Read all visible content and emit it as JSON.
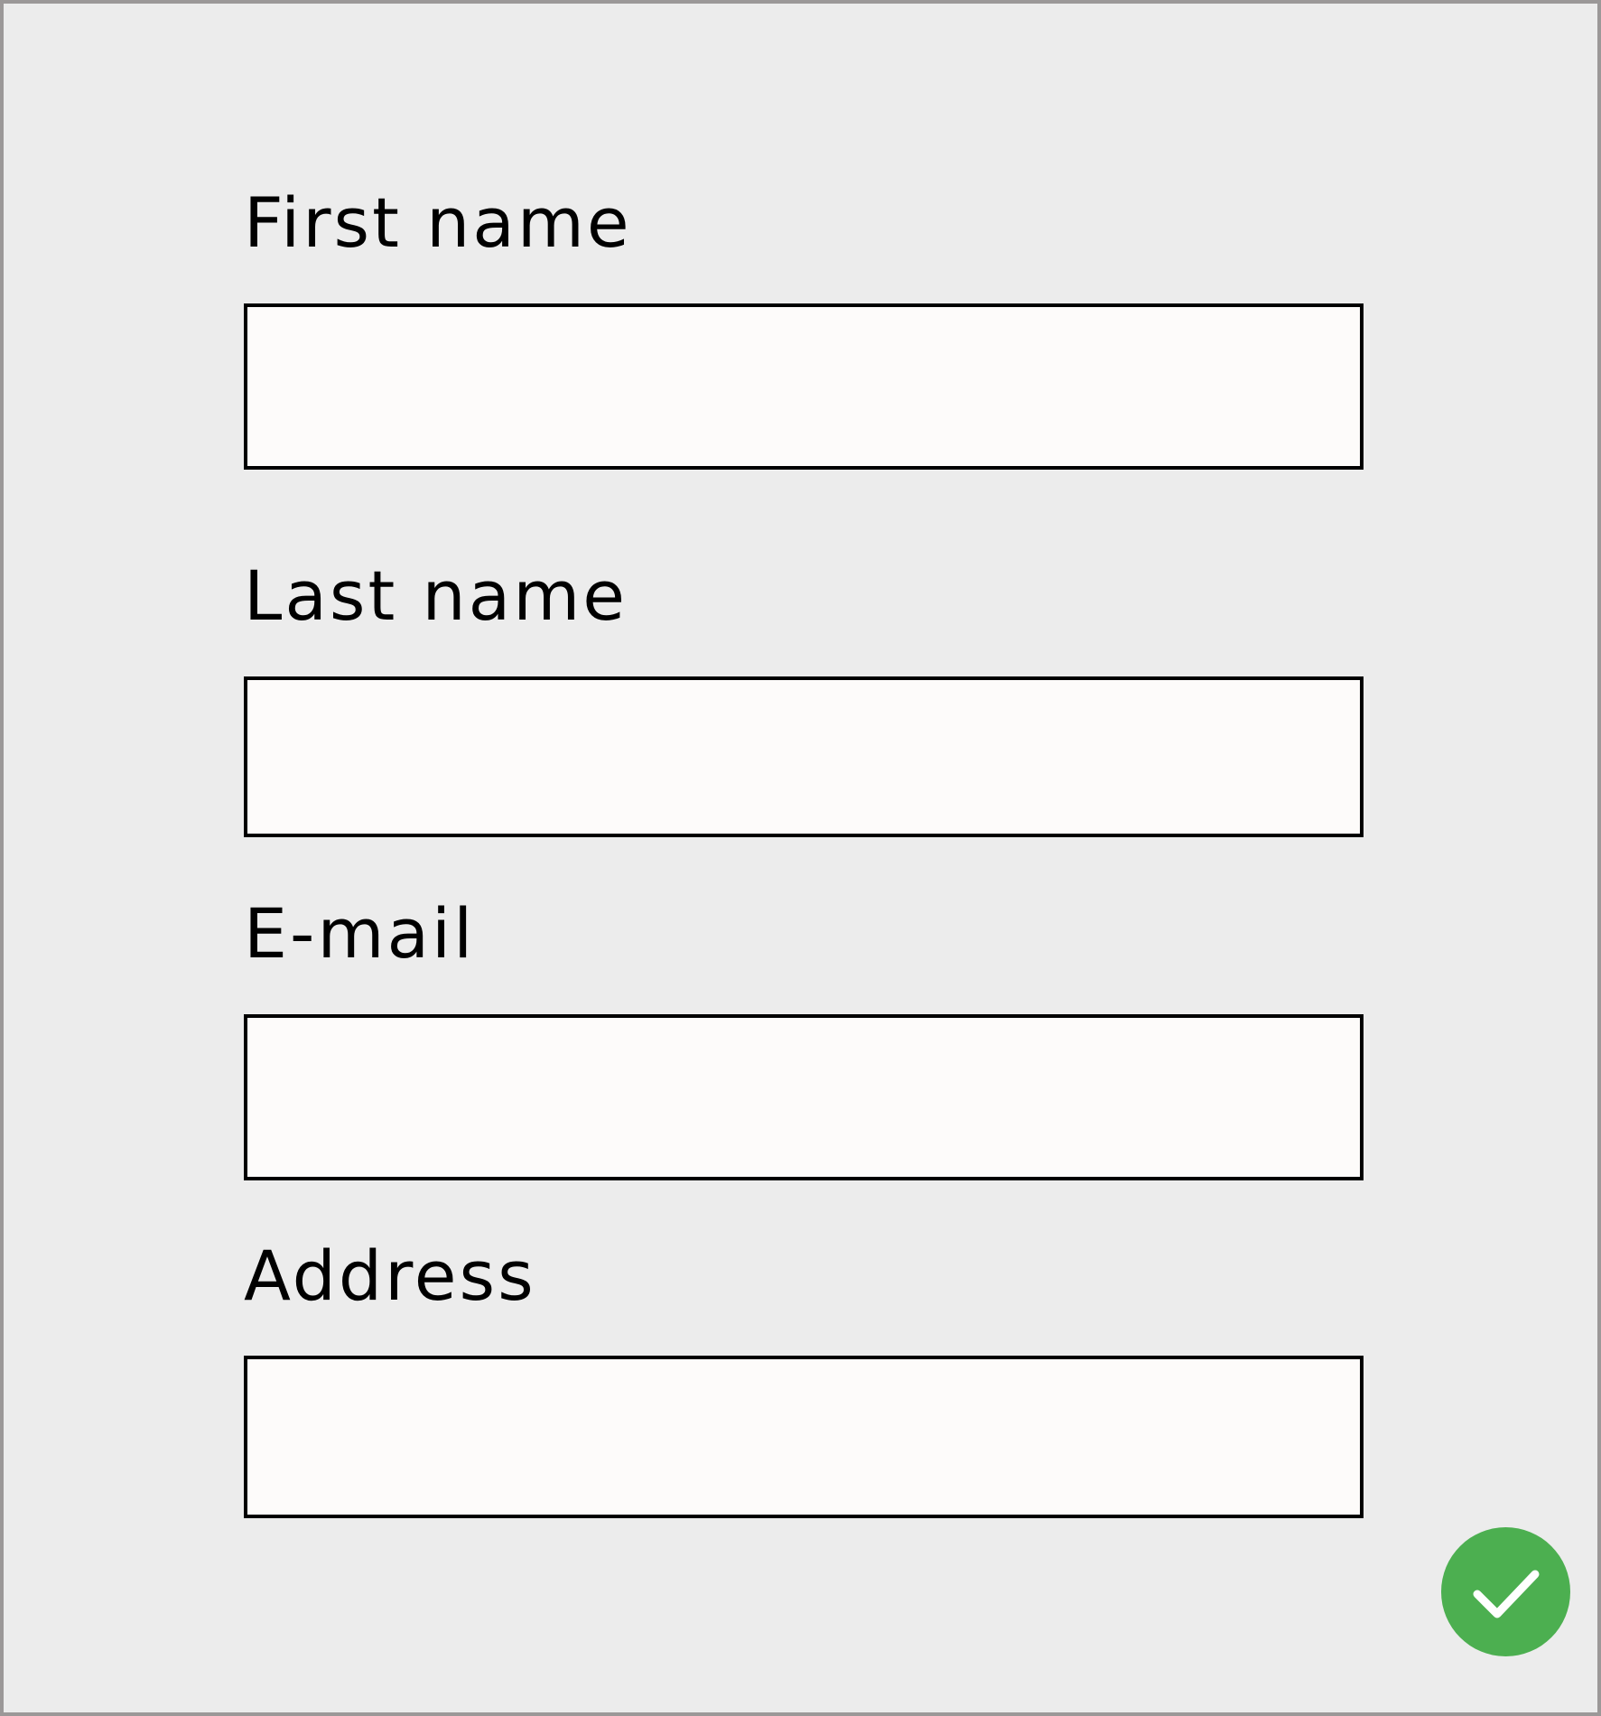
{
  "form": {
    "fields": [
      {
        "label": "First name",
        "value": "",
        "placeholder": ""
      },
      {
        "label": "Last name",
        "value": "",
        "placeholder": ""
      },
      {
        "label": "E-mail",
        "value": "",
        "placeholder": ""
      },
      {
        "label": "Address",
        "value": "",
        "placeholder": ""
      }
    ],
    "confirm_button": {
      "icon": "checkmark-icon",
      "color": "#4caf50"
    }
  },
  "colors": {
    "background": "#ececec",
    "frame_border": "#9b9898",
    "input_background": "#fdfbfa",
    "input_border": "#000000",
    "accent": "#4caf50"
  }
}
